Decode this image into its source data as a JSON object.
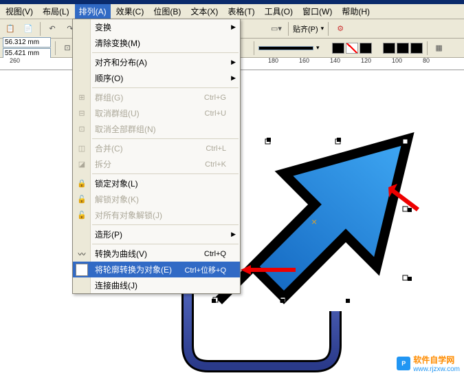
{
  "menubar": {
    "items": [
      "视图(V)",
      "布局(L)",
      "排列(A)",
      "效果(C)",
      "位图(B)",
      "文本(X)",
      "表格(T)",
      "工具(O)",
      "窗口(W)",
      "帮助(H)"
    ],
    "active_index": 2
  },
  "toolbar": {
    "paste_label": "贴齐(P)"
  },
  "propbar": {
    "width": "56.312 mm",
    "height": "55.421 mm"
  },
  "ruler": {
    "labels": [
      "260",
      "",
      "",
      "180",
      "160",
      "140",
      "120",
      "100",
      "80"
    ]
  },
  "dropdown": {
    "items": [
      {
        "label": "变换",
        "arrow": true
      },
      {
        "label": "清除变换(M)"
      },
      {
        "sep": true
      },
      {
        "label": "对齐和分布(A)",
        "arrow": true
      },
      {
        "label": "顺序(O)",
        "arrow": true
      },
      {
        "sep": true
      },
      {
        "label": "群组(G)",
        "shortcut": "Ctrl+G",
        "disabled": true,
        "icon": "group-icon"
      },
      {
        "label": "取消群组(U)",
        "shortcut": "Ctrl+U",
        "disabled": true,
        "icon": "ungroup-icon"
      },
      {
        "label": "取消全部群组(N)",
        "disabled": true,
        "icon": "ungroupall-icon"
      },
      {
        "sep": true
      },
      {
        "label": "合并(C)",
        "shortcut": "Ctrl+L",
        "disabled": true,
        "icon": "combine-icon"
      },
      {
        "label": "拆分",
        "shortcut": "Ctrl+K",
        "disabled": true,
        "icon": "break-icon"
      },
      {
        "sep": true
      },
      {
        "label": "锁定对象(L)",
        "icon": "lock-icon"
      },
      {
        "label": "解锁对象(K)",
        "disabled": true,
        "icon": "unlock-icon"
      },
      {
        "label": "对所有对象解锁(J)",
        "disabled": true,
        "icon": "unlockall-icon"
      },
      {
        "sep": true
      },
      {
        "label": "造形(P)",
        "arrow": true
      },
      {
        "sep": true
      },
      {
        "label": "转换为曲线(V)",
        "shortcut": "Ctrl+Q",
        "icon": "curve-icon"
      },
      {
        "label": "将轮廓转换为对象(E)",
        "shortcut": "Ctrl+位移+Q",
        "highlight": true,
        "icon": "outline-icon"
      },
      {
        "label": "连接曲线(J)"
      }
    ]
  },
  "watermark": {
    "name": "软件自学网",
    "url": "www.rjzxw.com"
  }
}
